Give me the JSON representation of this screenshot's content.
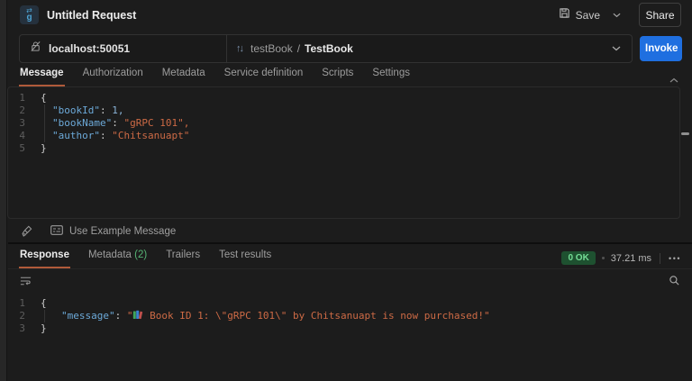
{
  "header": {
    "title": "Untitled Request",
    "save_label": "Save",
    "share_label": "Share"
  },
  "icons": {
    "grpc_tile_arrows": "⇄",
    "grpc_tile_letter": "g",
    "method_arrows": "↑↓",
    "more_menu": "•••"
  },
  "url_bar": {
    "server_url": "localhost:50051",
    "service": "testBook",
    "separator": "/",
    "method": "TestBook",
    "invoke_label": "Invoke"
  },
  "request_tabs": {
    "items": [
      {
        "label": "Message",
        "active": true
      },
      {
        "label": "Authorization",
        "active": false
      },
      {
        "label": "Metadata",
        "active": false
      },
      {
        "label": "Service definition",
        "active": false
      },
      {
        "label": "Scripts",
        "active": false
      },
      {
        "label": "Settings",
        "active": false
      }
    ]
  },
  "request_editor": {
    "line_numbers": [
      "1",
      "2",
      "3",
      "4",
      "5"
    ],
    "code": {
      "open_brace": "{",
      "lines": [
        {
          "key": "\"bookId\"",
          "colon": ": ",
          "value": "1,",
          "value_type": "number"
        },
        {
          "key": "\"bookName\"",
          "colon": ": ",
          "value": "\"gRPC 101\",",
          "value_type": "string"
        },
        {
          "key": "\"author\"",
          "colon": ": ",
          "value": "\"Chitsanuapt\"",
          "value_type": "string"
        }
      ],
      "close_brace": "}"
    },
    "toolbar": {
      "example_button_label": "Use Example Message"
    }
  },
  "response": {
    "tabs": [
      {
        "label": "Response",
        "active": true
      },
      {
        "label": "Metadata",
        "count": "(2)",
        "active": false
      },
      {
        "label": "Trailers",
        "active": false
      },
      {
        "label": "Test results",
        "active": false
      }
    ],
    "status_badge": "0 OK",
    "time": "37.21 ms",
    "editor": {
      "line_numbers": [
        "1",
        "2",
        "3"
      ],
      "open_brace": "{",
      "key": "\"message\"",
      "colon": ": ",
      "value_open_quote": "\"",
      "emoji_char": "📚",
      "value_rest": " Book ID 1: \\\"gRPC 101\\\" by Chitsanuapt is now purchased!\"",
      "close_brace": "}"
    }
  },
  "colors": {
    "accent_orange_underline": "#b05a3a",
    "invoke_blue": "#1f6fe0",
    "status_green_text": "#74dd96",
    "status_green_bg": "#1e5130",
    "json_key_blue": "#6ca9d8",
    "json_string_orange": "#cd6a45",
    "background": "#1c1c1c"
  }
}
